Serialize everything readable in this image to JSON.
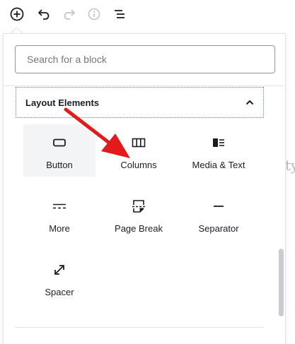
{
  "toolbar": {
    "buttons": [
      {
        "name": "add-block-icon"
      },
      {
        "name": "undo-icon"
      },
      {
        "name": "redo-icon"
      },
      {
        "name": "info-icon"
      },
      {
        "name": "outline-icon"
      }
    ]
  },
  "background": {
    "text_fragment": "ty"
  },
  "inserter": {
    "search": {
      "placeholder": "Search for a block",
      "value": ""
    },
    "panel": {
      "title": "Layout Elements",
      "expanded": true
    },
    "blocks": [
      {
        "label": "Button",
        "icon": "button-icon",
        "hovered": true
      },
      {
        "label": "Columns",
        "icon": "columns-icon"
      },
      {
        "label": "Media & Text",
        "icon": "media-text-icon"
      },
      {
        "label": "More",
        "icon": "more-icon"
      },
      {
        "label": "Page Break",
        "icon": "page-break-icon"
      },
      {
        "label": "Separator",
        "icon": "separator-icon"
      },
      {
        "label": "Spacer",
        "icon": "spacer-icon"
      }
    ]
  },
  "annotation": {
    "arrow_color": "#e41a1a",
    "points_to": "Columns"
  }
}
